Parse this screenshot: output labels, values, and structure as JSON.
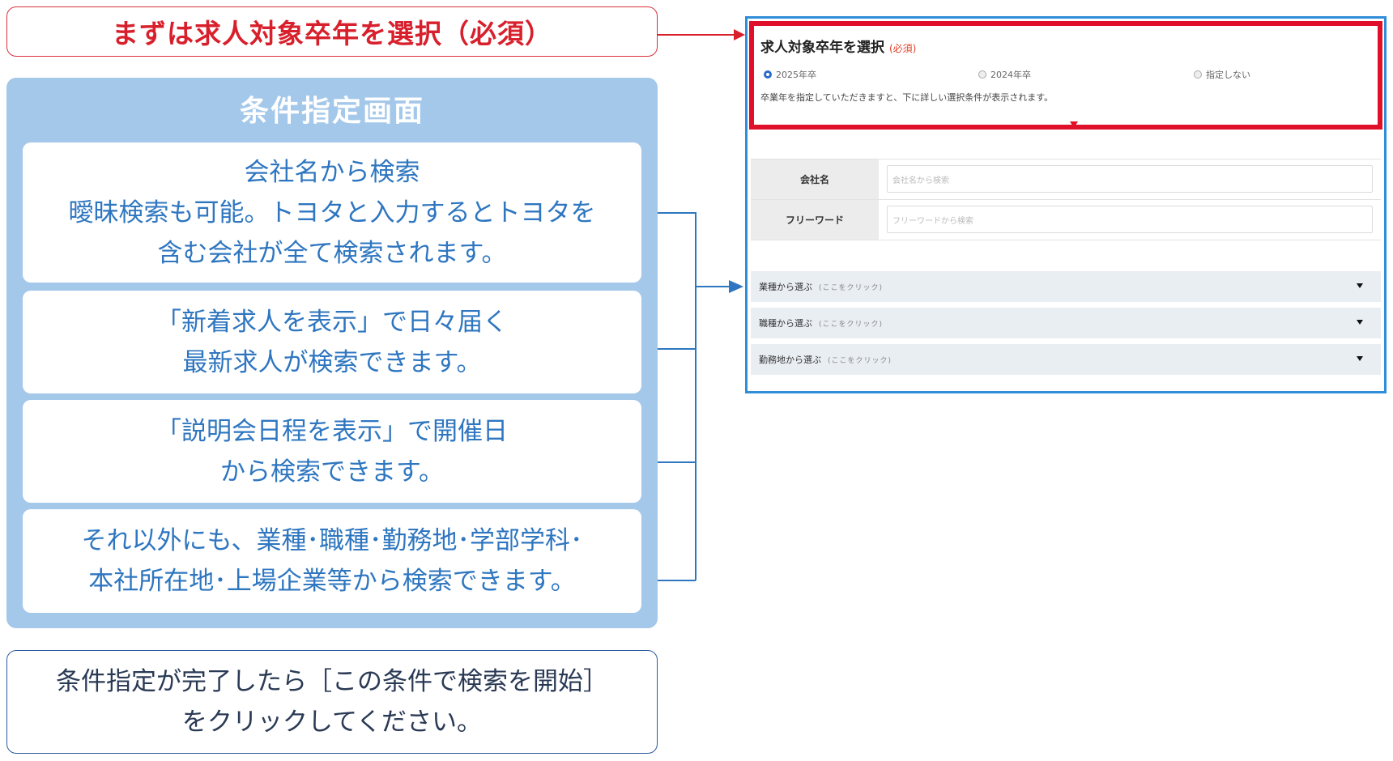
{
  "step_banner": "まずは求人対象卒年を選択（必須）",
  "panel": {
    "title": "条件指定画面",
    "cards": [
      {
        "lines": [
          "会社名から検索",
          "曖昧検索も可能。トヨタと入力するとトヨタを",
          "含む会社が全て検索されます。"
        ]
      },
      {
        "lines": [
          "「新着求人を表示」で日々届く",
          "最新求人が検索できます。"
        ]
      },
      {
        "lines": [
          "「説明会日程を表示」で開催日",
          "から検索できます。"
        ]
      },
      {
        "lines": [
          "それ以外にも、業種･職種･勤務地･学部学科･",
          "本社所在地･上場企業等から検索できます。"
        ]
      }
    ]
  },
  "bottom_note": {
    "lines": [
      "条件指定が完了したら［この条件で検索を開始］",
      "をクリックしてください。"
    ]
  },
  "screen": {
    "select_title": "求人対象卒年を選択",
    "required_label": "(必須)",
    "radios": [
      {
        "label": "2025年卒",
        "selected": true
      },
      {
        "label": "2024年卒",
        "selected": false
      },
      {
        "label": "指定しない",
        "selected": false
      }
    ],
    "description": "卒業年を指定していただきますと、下に詳しい選択条件が表示されます。",
    "fields": [
      {
        "label": "会社名",
        "placeholder": "会社名から検索"
      },
      {
        "label": "フリーワード",
        "placeholder": "フリーワードから検索"
      }
    ],
    "accordions": [
      {
        "label": "業種から選ぶ",
        "hint": "(ここをクリック)"
      },
      {
        "label": "職種から選ぶ",
        "hint": "(ここをクリック)"
      },
      {
        "label": "勤務地から選ぶ",
        "hint": "(ここをクリック)"
      }
    ]
  },
  "colors": {
    "accent_red": "#d8202c",
    "accent_blue": "#2e76c0",
    "panel_bg": "#a4c8ea",
    "frame_blue": "#2e8ed8"
  }
}
